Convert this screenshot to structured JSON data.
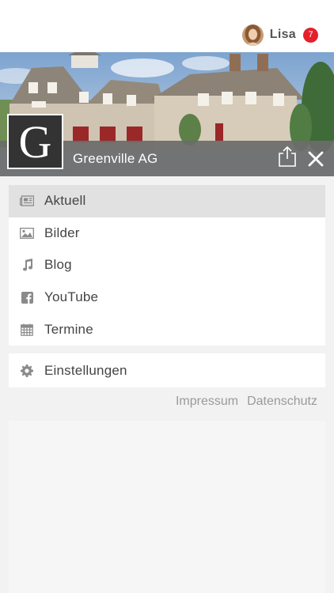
{
  "user": {
    "name": "Lisa",
    "notification_count": "7"
  },
  "hero": {
    "logo_letter": "G",
    "company_name": "Greenville AG"
  },
  "menu": {
    "items": [
      {
        "label": "Aktuell",
        "icon": "newspaper-icon",
        "active": true
      },
      {
        "label": "Bilder",
        "icon": "image-icon",
        "active": false
      },
      {
        "label": "Blog",
        "icon": "music-note-icon",
        "active": false
      },
      {
        "label": "YouTube",
        "icon": "facebook-icon",
        "active": false
      },
      {
        "label": "Termine",
        "icon": "calendar-icon",
        "active": false
      }
    ]
  },
  "settings": {
    "label": "Einstellungen",
    "icon": "gear-icon"
  },
  "footer": {
    "impressum": "Impressum",
    "datenschutz": "Datenschutz"
  },
  "colors": {
    "badge": "#e4202c",
    "hero_bar": "#6c6c6c",
    "active_item": "#e1e1e1",
    "background": "#f2f2f2"
  }
}
